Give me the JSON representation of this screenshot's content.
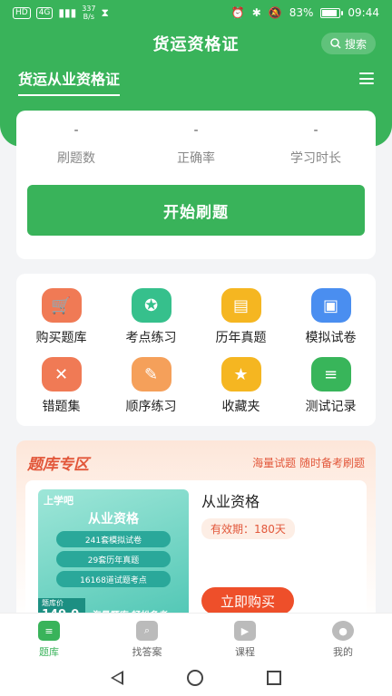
{
  "status": {
    "left_badges": [
      "HD",
      "4G"
    ],
    "speed": "337\nB/s",
    "battery": "83%",
    "time": "09:44"
  },
  "header": {
    "title": "货运资格证",
    "search_label": "搜索"
  },
  "category": {
    "label": "货运从业资格证"
  },
  "stats": [
    {
      "value": "-",
      "label": "刷题数"
    },
    {
      "value": "-",
      "label": "正确率"
    },
    {
      "value": "-",
      "label": "学习时长"
    }
  ],
  "start_button": "开始刷题",
  "features": [
    {
      "label": "购买题库",
      "icon": "cart-icon",
      "color": "#f07a55"
    },
    {
      "label": "考点练习",
      "icon": "star-icon",
      "color": "#36c08c"
    },
    {
      "label": "历年真题",
      "icon": "calendar-icon",
      "color": "#f5b621"
    },
    {
      "label": "模拟试卷",
      "icon": "monitor-icon",
      "color": "#4a8ef0"
    },
    {
      "label": "错题集",
      "icon": "error-icon",
      "color": "#f07a55"
    },
    {
      "label": "顺序练习",
      "icon": "doc-edit-icon",
      "color": "#f5a05a"
    },
    {
      "label": "收藏夹",
      "icon": "star-icon",
      "color": "#f5b621"
    },
    {
      "label": "测试记录",
      "icon": "record-icon",
      "color": "#38b55a"
    }
  ],
  "bank": {
    "title": "题库专区",
    "slogan": "海量试题 随时备考刷题",
    "product": {
      "cover_brand": "上学吧",
      "cover_title": "从业资格",
      "cover_pills": [
        "241套模拟试卷",
        "29套历年真题",
        "16168道试题考点"
      ],
      "cover_price_label": "题库价",
      "cover_price": "149.0",
      "cover_slogan": "海量题库 轻松备考",
      "title": "从业资格",
      "validity": "有效期：180天",
      "buy_label": "立即购买"
    }
  },
  "tabs": [
    {
      "label": "题库",
      "icon": "question-bank-icon",
      "active": true
    },
    {
      "label": "找答案",
      "icon": "search-answer-icon",
      "active": false
    },
    {
      "label": "课程",
      "icon": "video-course-icon",
      "active": false
    },
    {
      "label": "我的",
      "icon": "profile-icon",
      "active": false
    }
  ]
}
